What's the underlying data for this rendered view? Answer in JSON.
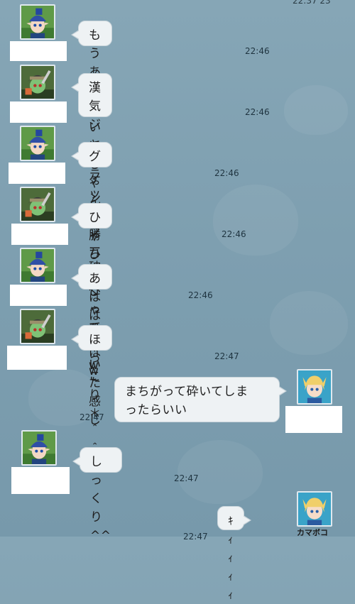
{
  "header": {
    "partial_time": "22:37 23"
  },
  "messages": [
    {
      "side": "left",
      "avatar": "elf-blue-hat",
      "text": "もうあれでいいじゃん",
      "time": "22:46"
    },
    {
      "side": "left",
      "avatar": "green-skin-char",
      "text": "漢気ジャンケンで勝ち\nまくって砕いた感じ",
      "time": "22:46"
    },
    {
      "side": "left",
      "avatar": "elf-blue-hat",
      "text": "グラップラー破片",
      "time": "22:46"
    },
    {
      "side": "left",
      "avatar": "green-skin-char",
      "text": "ひゃひゃひゃひゃw",
      "time": "22:46"
    },
    {
      "side": "left",
      "avatar": "elf-blue-hat",
      "text": "あははははw",
      "time": "22:46"
    },
    {
      "side": "left",
      "avatar": "green-skin-char",
      "text": "ほっこり＊＾＾＊",
      "time": "22:47"
    },
    {
      "side": "right",
      "avatar": "blonde-char",
      "text": "まちがって砕いてしま\nったらいい",
      "time": "22:47"
    },
    {
      "side": "left",
      "avatar": "elf-blue-hat",
      "text": "しっくり^^",
      "time": "22:47"
    },
    {
      "side": "right",
      "avatar": "blonde-char",
      "text": "ｷｨｨｨｨ",
      "time": "22:47",
      "name": "カマボコ"
    }
  ],
  "colors": {
    "background": "#7e9fb0",
    "bubble": "#eef2f4",
    "time_text": "#1f3440"
  }
}
